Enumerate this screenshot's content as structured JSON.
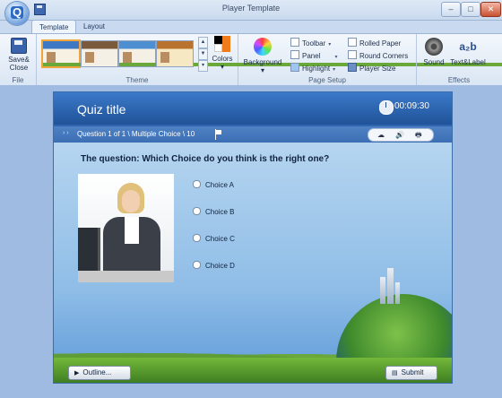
{
  "window": {
    "title": "Player Template",
    "minimize": "–",
    "maximize": "□",
    "close": "✕"
  },
  "tabs": [
    {
      "label": "Template"
    },
    {
      "label": "Layout"
    }
  ],
  "ribbon": {
    "file": {
      "save_label": "Save&",
      "close_label": "Close",
      "group_label": "File"
    },
    "theme": {
      "group_label": "Theme",
      "colors_label": "Colors",
      "scroll_up": "▲",
      "scroll_down": "▼",
      "more": "▾"
    },
    "page_setup": {
      "group_label": "Page Setup",
      "background_label": "Background",
      "toolbar_label": "Toolbar",
      "panel_label": "Panel",
      "highlight_label": "Highlight",
      "rolled_paper_label": "Rolled Paper",
      "round_corners_label": "Round Corners",
      "player_size_label": "Player Size",
      "dropdown": "▾"
    },
    "effects": {
      "group_label": "Effects",
      "sound_label": "Sound",
      "text_label_label": "Text&Label",
      "text_icon": "a₂b"
    }
  },
  "player": {
    "title": "Quiz title",
    "timer": "00:09:30",
    "nav_arrows": "› ›",
    "question_nav": "Question 1 of 1 \\ Multiple Choice \\ 10",
    "tool_icons": [
      "☁",
      "🔊",
      "🖶"
    ],
    "question_prefix": "The question:",
    "question_text": "Which Choice do you think is the right one?",
    "choices": [
      "Choice A",
      "Choice B",
      "Choice C",
      "Choice D"
    ],
    "outline_label": "Outline...",
    "outline_icon": "▶",
    "submit_label": "Submit",
    "submit_icon": "▤"
  }
}
